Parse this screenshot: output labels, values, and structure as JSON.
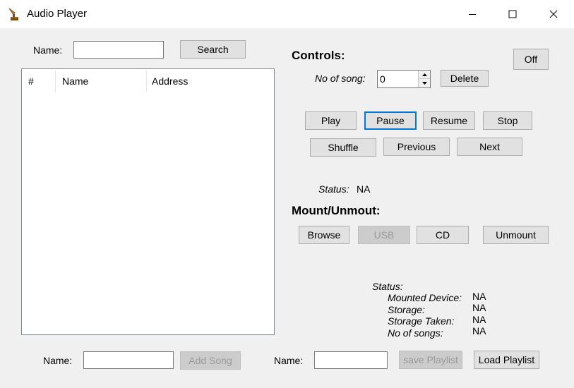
{
  "window": {
    "title": "Audio Player",
    "controls": {
      "minimize": "—",
      "maximize": "☐",
      "close": "✕"
    }
  },
  "search": {
    "name_label": "Name:",
    "name_value": "",
    "search_button": "Search"
  },
  "list": {
    "columns": [
      "#",
      "Name",
      "Address"
    ],
    "rows": []
  },
  "controls": {
    "heading": "Controls:",
    "off_button": "Off",
    "no_of_song_label": "No of song:",
    "no_of_song_value": "0",
    "delete_button": "Delete",
    "play": "Play",
    "pause": "Pause",
    "resume": "Resume",
    "stop": "Stop",
    "shuffle": "Shuffle",
    "previous": "Previous",
    "next": "Next",
    "status_label": "Status:",
    "status_value": "NA"
  },
  "mount": {
    "heading": "Mount/Unmout:",
    "browse": "Browse",
    "usb": "USB",
    "cd": "CD",
    "unmount": "Unmount",
    "status_label": "Status:",
    "mounted_device_label": "Mounted Device:",
    "mounted_device_value": "NA",
    "storage_label": "Storage:",
    "storage_value": "NA",
    "storage_taken_label": "Storage Taken:",
    "storage_taken_value": "NA",
    "no_of_songs_label": "No of songs:",
    "no_of_songs_value": "NA"
  },
  "bottom": {
    "song_name_label": "Name:",
    "song_name_value": "",
    "add_song_button": "Add Song",
    "playlist_name_label": "Name:",
    "playlist_name_value": "",
    "save_playlist_button": "save Playlist",
    "load_playlist_button": "Load Playlist"
  },
  "colors": {
    "window_bg": "#f0f0f0",
    "focus_border": "#0078d7",
    "button_bg": "#e1e1e1"
  }
}
